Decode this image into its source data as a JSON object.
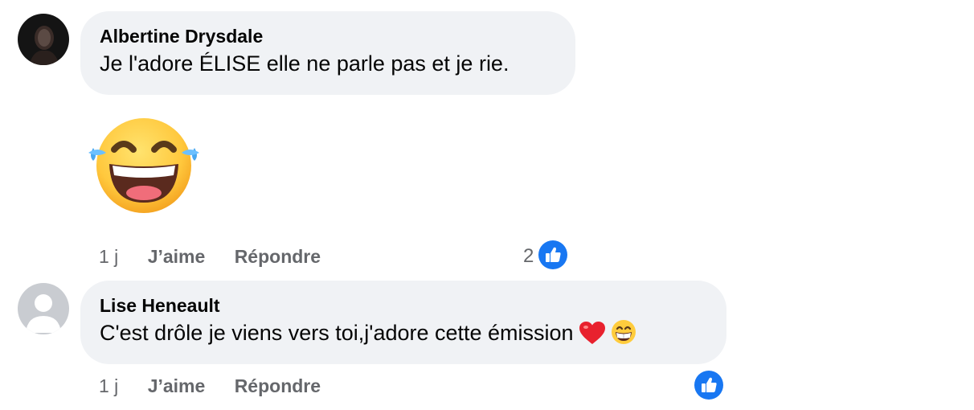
{
  "comments": [
    {
      "author": "Albertine Drysdale",
      "text": "Je l'adore ÉLISE elle ne parle pas et je rie.",
      "time": "1 j",
      "like_label": "J’aime",
      "reply_label": "Répondre",
      "reaction_count": "2",
      "attachment_icon": "face-with-tears-of-joy"
    },
    {
      "author": "Lise Heneault",
      "text": "C'est drôle je viens vers toi,j'adore cette émission",
      "time": "1 j",
      "like_label": "J’aime",
      "reply_label": "Répondre",
      "inline_icons": [
        "red-heart",
        "grinning-face-with-smiling-eyes"
      ]
    }
  ],
  "colors": {
    "bubble": "#f0f2f5",
    "secondary_text": "#65676b",
    "like_blue": "#1877f2"
  }
}
